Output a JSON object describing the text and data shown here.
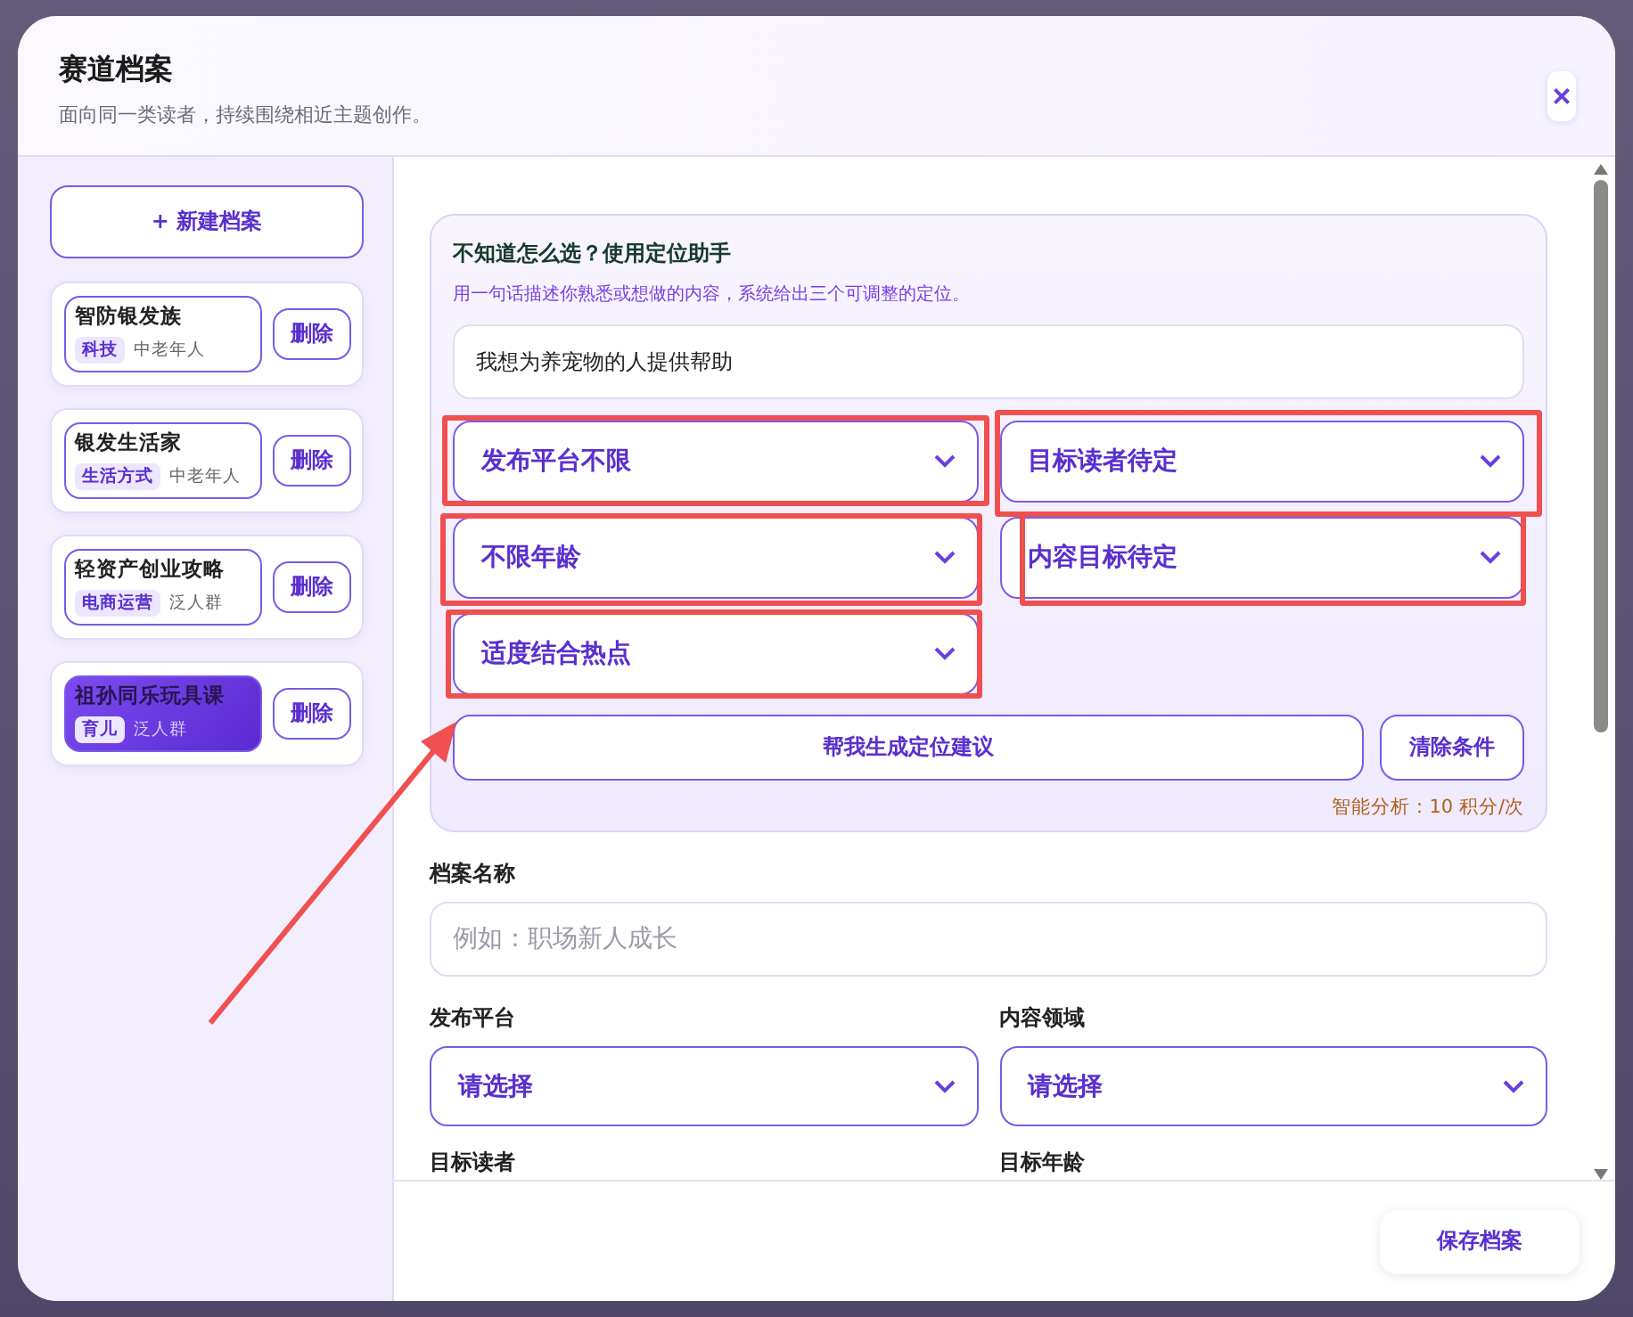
{
  "dialog": {
    "title": "赛道档案",
    "subtitle": "面向同一类读者，持续围绕相近主题创作。",
    "close": "×"
  },
  "sidebar": {
    "new_button": "+ 新建档案",
    "items": [
      {
        "name": "智防银发族",
        "tag": "科技",
        "audience": "中老年人",
        "delete": "删除",
        "selected": false
      },
      {
        "name": "银发生活家",
        "tag": "生活方式",
        "audience": "中老年人",
        "delete": "删除",
        "selected": false
      },
      {
        "name": "轻资产创业攻略",
        "tag": "电商运营",
        "audience": "泛人群",
        "delete": "删除",
        "selected": false
      },
      {
        "name": "祖孙同乐玩具课",
        "tag": "育儿",
        "audience": "泛人群",
        "delete": "删除",
        "selected": true
      }
    ]
  },
  "assistant": {
    "title": "不知道怎么选？使用定位助手",
    "hint": "用一句话描述你熟悉或想做的内容，系统给出三个可调整的定位。",
    "input_value": "我想为养宠物的人提供帮助",
    "selects": [
      {
        "value": "发布平台不限",
        "highlighted": true
      },
      {
        "value": "目标读者待定",
        "highlighted": true
      },
      {
        "value": "不限年龄",
        "highlighted": true
      },
      {
        "value": "内容目标待定",
        "highlighted": true
      },
      {
        "value": "适度结合热点",
        "highlighted": true
      }
    ],
    "generate_button": "帮我生成定位建议",
    "clear_button": "清除条件",
    "cost": "智能分析：10 积分/次",
    "arrow_annotation": true
  },
  "form": {
    "name_label": "档案名称",
    "name_placeholder": "例如：职场新人成长",
    "fields": [
      {
        "label": "发布平台",
        "value": "请选择"
      },
      {
        "label": "内容领域",
        "value": "请选择"
      }
    ],
    "next_labels": [
      "目标读者",
      "目标年龄"
    ]
  },
  "footer": {
    "save_button": "保存档案"
  }
}
